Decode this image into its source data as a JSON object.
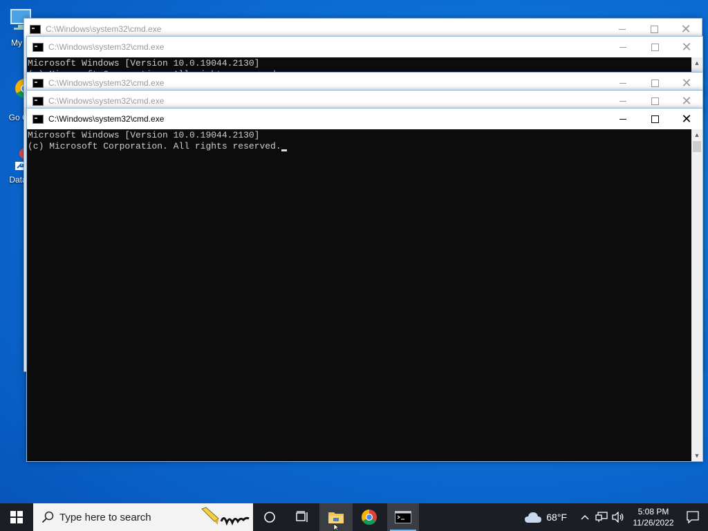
{
  "desktop": {
    "icons": [
      {
        "label": "My C"
      },
      {
        "label": "Go Ch"
      },
      {
        "label": "DataV"
      }
    ]
  },
  "windows": [
    {
      "title": "C:\\Windows\\system32\\cmd.exe"
    },
    {
      "title": "C:\\Windows\\system32\\cmd.exe",
      "console": [
        "Microsoft Windows [Version 10.0.19044.2130]",
        "(c) Microsoft Corporation. All rights reserved."
      ]
    },
    {
      "title": "C:\\Windows\\system32\\cmd.exe"
    },
    {
      "title": "C:\\Windows\\system32\\cmd.exe"
    },
    {
      "title": "C:\\Windows\\system32\\cmd.exe",
      "console": [
        "Microsoft Windows [Version 10.0.19044.2130]",
        "(c) Microsoft Corporation. All rights reserved."
      ]
    }
  ],
  "taskbar": {
    "search_placeholder": "Type here to search",
    "weather": "68°F",
    "time": "5:08 PM",
    "date": "11/26/2022"
  },
  "colors": {
    "console_bg": "#0c0c0c",
    "console_fg": "#cccccc",
    "taskbar_bg": "#1b1e24",
    "running_indicator": "#76b9ed"
  }
}
